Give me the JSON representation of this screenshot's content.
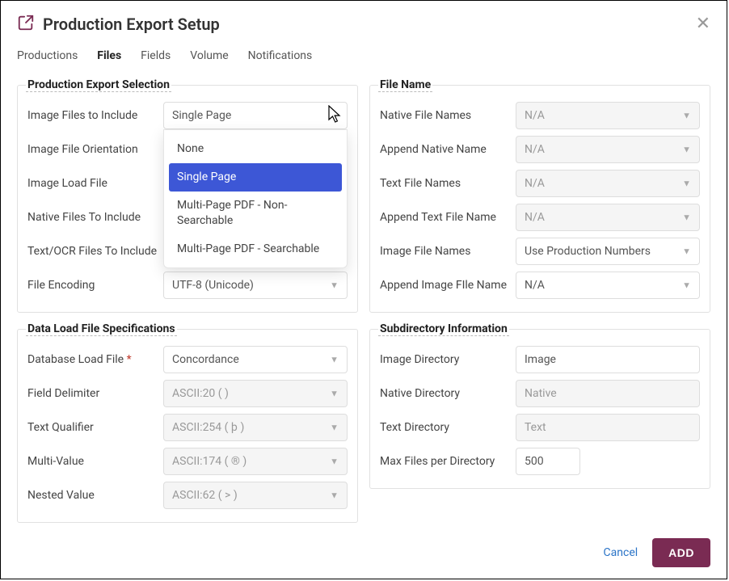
{
  "header": {
    "title": "Production Export Setup"
  },
  "tabs": [
    "Productions",
    "Files",
    "Fields",
    "Volume",
    "Notifications"
  ],
  "left": {
    "selection": {
      "title": "Production Export Selection",
      "rows": [
        {
          "label": "Image Files to Include",
          "value": "Single Page",
          "options": [
            "None",
            "Single Page",
            "Multi-Page PDF - Non-Searchable",
            "Multi-Page PDF - Searchable"
          ]
        },
        {
          "label": "Image File Orientation"
        },
        {
          "label": "Image Load File"
        },
        {
          "label": "Native Files To Include"
        },
        {
          "label": "Text/OCR Files To Include"
        },
        {
          "label": "File Encoding",
          "value": "UTF-8 (Unicode)"
        }
      ]
    },
    "dataload": {
      "title": "Data Load File Specifications",
      "rows": [
        {
          "label": "Database Load File",
          "value": "Concordance",
          "required": true
        },
        {
          "label": "Field Delimiter",
          "value": "ASCII:20 (   )"
        },
        {
          "label": "Text Qualifier",
          "value": "ASCII:254 ( þ )"
        },
        {
          "label": "Multi-Value",
          "value": "ASCII:174 ( ® )"
        },
        {
          "label": "Nested Value",
          "value": "ASCII:62 ( > )"
        }
      ]
    }
  },
  "right": {
    "filename": {
      "title": "File Name",
      "rows": [
        {
          "label": "Native File Names",
          "value": "N/A"
        },
        {
          "label": "Append Native Name",
          "value": "N/A"
        },
        {
          "label": "Text File Names",
          "value": "N/A"
        },
        {
          "label": "Append Text File Name",
          "value": "N/A"
        },
        {
          "label": "Image File Names",
          "value": "Use Production Numbers"
        },
        {
          "label": "Append Image FIle Name",
          "value": "N/A"
        }
      ]
    },
    "subdir": {
      "title": "Subdirectory Information",
      "rows": [
        {
          "label": "Image Directory",
          "value": "Image"
        },
        {
          "label": "Native Directory",
          "value": "Native"
        },
        {
          "label": "Text Directory",
          "value": "Text"
        },
        {
          "label": "Max Files per Directory",
          "value": "500"
        }
      ]
    }
  },
  "footer": {
    "cancel": "Cancel",
    "add": "ADD"
  }
}
